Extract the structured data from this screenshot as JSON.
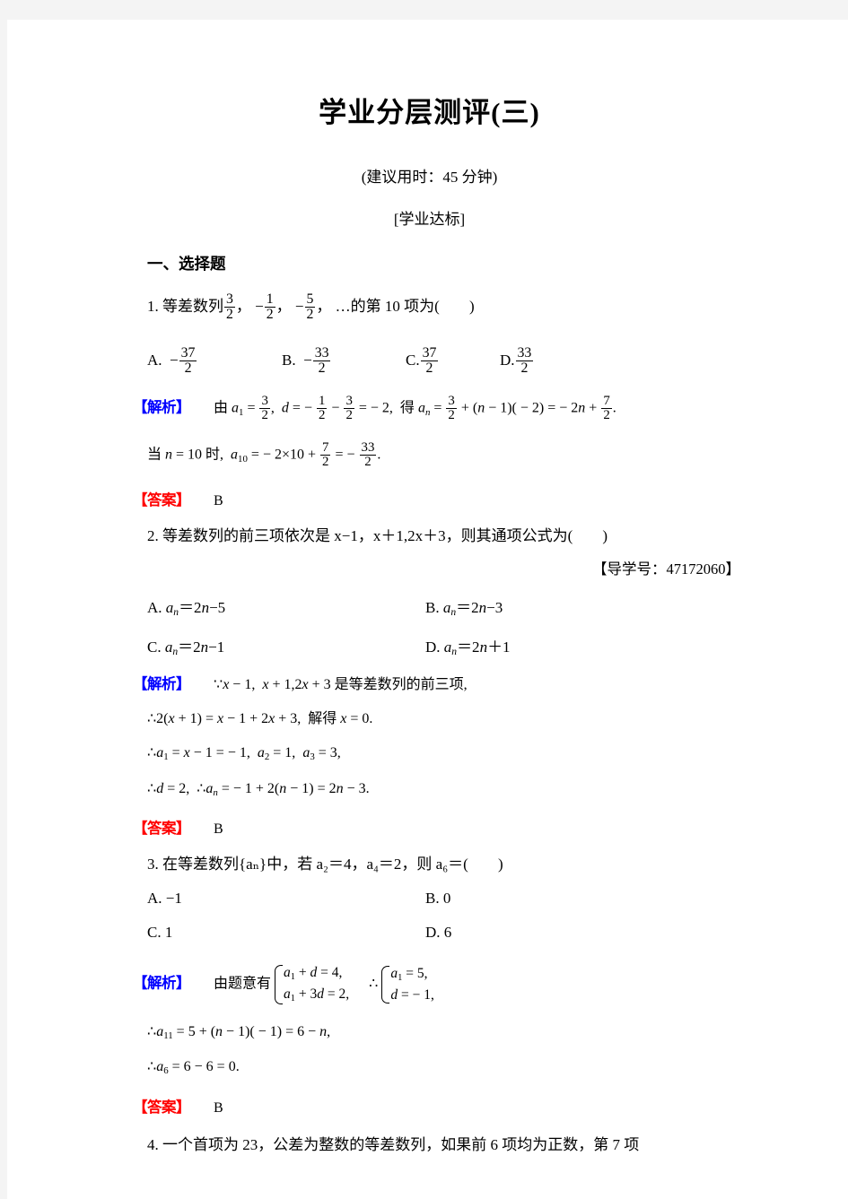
{
  "document": {
    "title": "学业分层测评(三)",
    "subtitle": "(建议用时：45 分钟)",
    "section_tag": "[学业达标]",
    "part_heading": "一、选择题"
  },
  "labels": {
    "analysis": "【解析】",
    "answer": "【答案】",
    "guide_number": "【导学号：47172060】"
  },
  "colors": {
    "analysis_label": "#0000FF",
    "answer_label": "#FF0000",
    "text": "#000000",
    "page_background": "#FFFFFF",
    "canvas_background": "#F4F4F4"
  },
  "questions": [
    {
      "number": "1.",
      "stem_prefix": "等差数列",
      "stem_terms": [
        "3/2",
        "-1/2",
        "-5/2"
      ],
      "stem_suffix": "…的第 10 项为(",
      "stem_close": ")",
      "options": [
        {
          "key": "A.",
          "value": "-37/2"
        },
        {
          "key": "B.",
          "value": "-33/2"
        },
        {
          "key": "C.",
          "value": "37/2"
        },
        {
          "key": "D.",
          "value": "33/2"
        }
      ],
      "solution_lines": [
        "由 a₁ = 3/2, d = -1/2 - 3/2 = -2, 得 aₙ = 3/2 + (n-1)(-2) = -2n + 7/2.",
        "当 n = 10 时, a₁₀ = -2×10 + 7/2 = -33/2."
      ],
      "answer": "B"
    },
    {
      "number": "2.",
      "stem": "等差数列的前三项依次是 x−1，x＋1,2x＋3，则其通项公式为(",
      "stem_close": ")",
      "guide_number": "【导学号：47172060】",
      "options": [
        {
          "key": "A.",
          "value": "aₙ=2n−5"
        },
        {
          "key": "B.",
          "value": "aₙ=2n−3"
        },
        {
          "key": "C.",
          "value": "aₙ=2n−1"
        },
        {
          "key": "D.",
          "value": "aₙ=2n＋1"
        }
      ],
      "solution_lines": [
        "∵x − 1, x + 1,2x + 3 是等差数列的前三项,",
        "∴2(x + 1) = x − 1 + 2x + 3, 解得 x = 0.",
        "∴a₁ = x − 1 = − 1, a₂ = 1, a₃ = 3,",
        "∴d = 2, ∴aₙ = − 1 + 2(n − 1) = 2n − 3."
      ],
      "answer": "B"
    },
    {
      "number": "3.",
      "stem": "在等差数列{aₙ}中，若 a₂＝4，a₄＝2，则 a₆＝(",
      "stem_close": ")",
      "options": [
        {
          "key": "A.",
          "value": "−1"
        },
        {
          "key": "B.",
          "value": "0"
        },
        {
          "key": "C.",
          "value": "1"
        },
        {
          "key": "D.",
          "value": "6"
        }
      ],
      "solution_intro": "由题意有",
      "system_left": [
        "a₁ + d = 4,",
        "a₁ + 3d = 2,"
      ],
      "system_right": [
        "a₁ = 5,",
        "d = − 1,"
      ],
      "solution_lines": [
        "∴a₁₁ = 5 + (n − 1)( − 1) = 6 − n,",
        "∴a₆ = 6 − 6 = 0."
      ],
      "answer": "B"
    },
    {
      "number": "4.",
      "stem": "一个首项为 23，公差为整数的等差数列，如果前 6 项均为正数，第 7 项"
    }
  ],
  "math_text": {
    "q1_sol_l1_p1": "由",
    "q1_sol_l1_p2": "= 3/2,",
    "q1_sol_l1_p3": "得",
    "q1_sol_l2_p1": "当",
    "q1_sol_l2_when": "时,",
    "q3_therefore": "∴"
  }
}
